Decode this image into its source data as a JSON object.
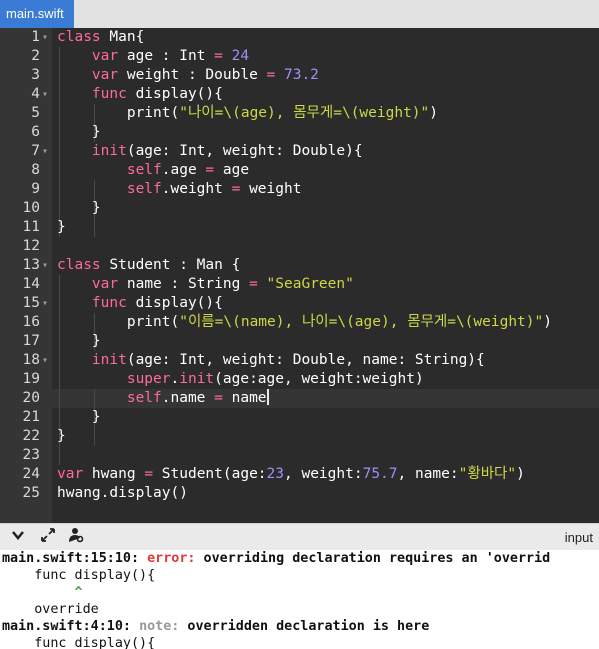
{
  "tab": {
    "title": "main.swift"
  },
  "editor": {
    "lines": [
      {
        "n": "1",
        "fold": true
      },
      {
        "n": "2"
      },
      {
        "n": "3"
      },
      {
        "n": "4",
        "fold": true
      },
      {
        "n": "5"
      },
      {
        "n": "6"
      },
      {
        "n": "7",
        "fold": true
      },
      {
        "n": "8"
      },
      {
        "n": "9"
      },
      {
        "n": "10"
      },
      {
        "n": "11"
      },
      {
        "n": "12"
      },
      {
        "n": "13",
        "fold": true
      },
      {
        "n": "14"
      },
      {
        "n": "15",
        "fold": true
      },
      {
        "n": "16"
      },
      {
        "n": "17"
      },
      {
        "n": "18",
        "fold": true
      },
      {
        "n": "19"
      },
      {
        "n": "20"
      },
      {
        "n": "21"
      },
      {
        "n": "22"
      },
      {
        "n": "23"
      },
      {
        "n": "24"
      },
      {
        "n": "25"
      }
    ],
    "code": {
      "l1a": "class",
      "l1b": " Man{",
      "l2a": "var",
      "l2b": " age : Int ",
      "l2c": "=",
      "l2d": " 24",
      "l3a": "var",
      "l3b": " weight : Double ",
      "l3c": "=",
      "l3d": " 73.2",
      "l4a": "func",
      "l4b": " display(){",
      "l5a": "print(",
      "l5b": "\"나이=\\(age), 몸무게=\\(weight)\"",
      "l5c": ")",
      "l6": "}",
      "l7a": "init",
      "l7b": "(age: Int, weight: Double){",
      "l8a": "self",
      "l8b": ".age ",
      "l8c": "=",
      "l8d": " age",
      "l9a": "self",
      "l9b": ".weight ",
      "l9c": "=",
      "l9d": " weight",
      "l10": "}",
      "l11": "}",
      "l13a": "class",
      "l13b": " Student : Man {",
      "l14a": "var",
      "l14b": " name : String ",
      "l14c": "=",
      "l14d": " \"SeaGreen\"",
      "l15a": "func",
      "l15b": " display(){",
      "l16a": "print(",
      "l16b": "\"이름=\\(name), 나이=\\(age), 몸무게=\\(weight)\"",
      "l16c": ")",
      "l17": "}",
      "l18a": "init",
      "l18b": "(age: Int, weight: Double, name: String){",
      "l19a": "super",
      "l19b": ".",
      "l19c": "init",
      "l19d": "(age:age, weight:weight)",
      "l20a": "self",
      "l20b": ".name ",
      "l20c": "=",
      "l20d": " name",
      "l21": "}",
      "l22": "}",
      "l24a": "var",
      "l24b": " hwang ",
      "l24c": "=",
      "l24d": " Student(age:",
      "l24e": "23",
      "l24f": ", weight:",
      "l24g": "75.7",
      "l24h": ", name:",
      "l24i": "\"황바다\"",
      "l24j": ")",
      "l25": "hwang.display()"
    }
  },
  "toolbar": {
    "collapse_icon": "chevron-down-icon",
    "expand_icon": "expand-icon",
    "settings_icon": "user-settings-icon",
    "input_label": "input"
  },
  "console": {
    "line1a": "main.swift:15:10: ",
    "line1b": "error:",
    "line1c": " overriding declaration requires an 'overrid",
    "line2": "    func display(){",
    "line3": "         ^",
    "line4": "    override",
    "line5a": "main.swift:4:10: ",
    "line5b": "note:",
    "line5c": " overridden declaration is here",
    "line6": "    func display(){"
  },
  "colors": {
    "keyword": "#ff6b98",
    "number": "#a58cf5",
    "string": "#ccd845",
    "editor_bg": "#2b2b2b",
    "tab_bg": "#3a7bd5",
    "error": "#e03a3a"
  }
}
